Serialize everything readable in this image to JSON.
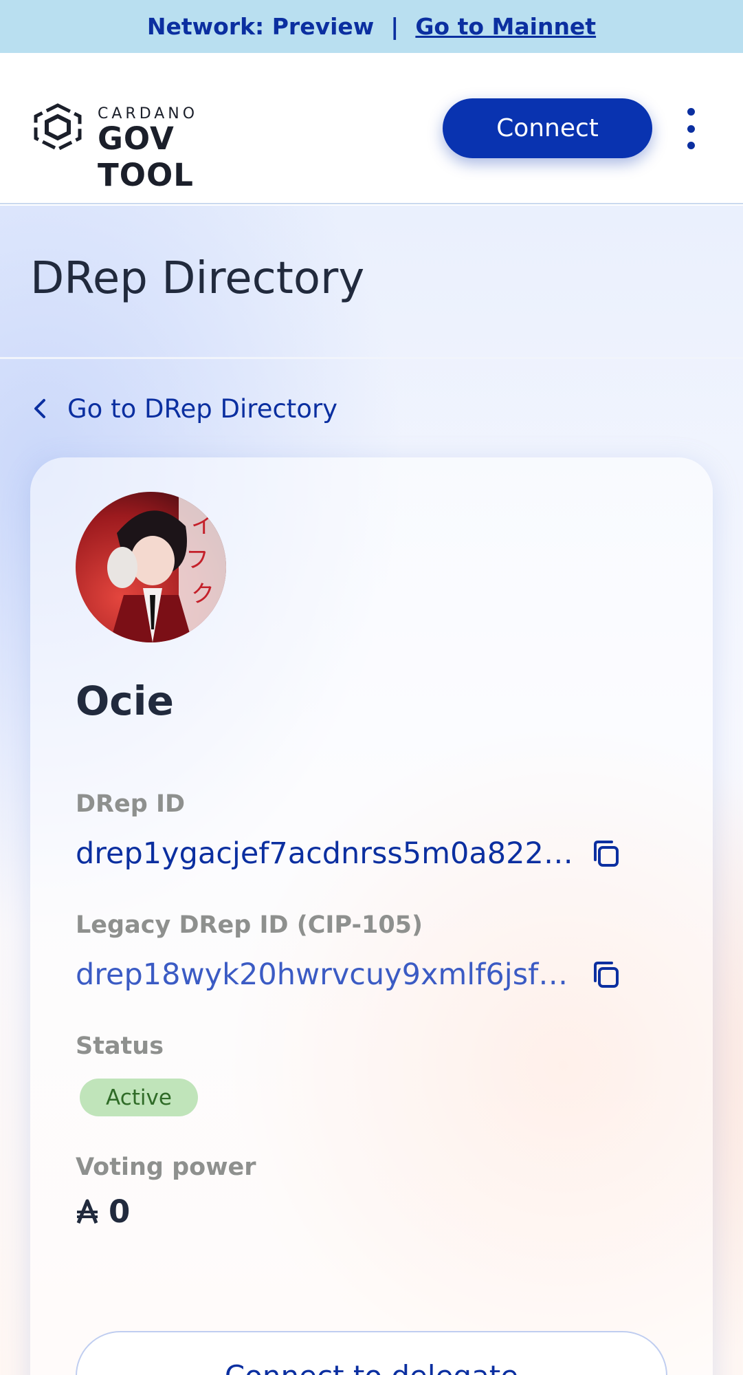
{
  "network_bar": {
    "label": "Network: Preview",
    "separator": "|",
    "mainnet_link": "Go to Mainnet"
  },
  "header": {
    "logo_small": "CARDANO",
    "logo_big": "GOV TOOL",
    "connect_label": "Connect",
    "menu_icon": "more-vertical-icon"
  },
  "page": {
    "title": "DRep Directory",
    "back_link": "Go to DRep Directory"
  },
  "drep": {
    "name": "Ocie",
    "drep_id_label": "DRep ID",
    "drep_id": "drep1ygacjef7acdnrss5m0a822…",
    "legacy_id_label": "Legacy DRep ID (CIP-105)",
    "legacy_id": "drep18wyk20hwrvcuy9xmlf6jsfv…",
    "status_label": "Status",
    "status": "Active",
    "voting_power_label": "Voting power",
    "voting_power": "0",
    "delegate_button": "Connect to delegate"
  },
  "colors": {
    "primary": "#0933b0",
    "network_bar": "#b9dff0",
    "status_active_bg": "#c0e4ba",
    "status_active_text": "#2f6b27"
  },
  "icons": [
    "cardano-govtool-logo-icon",
    "more-vertical-icon",
    "chevron-left-icon",
    "copy-icon",
    "ada-icon"
  ]
}
